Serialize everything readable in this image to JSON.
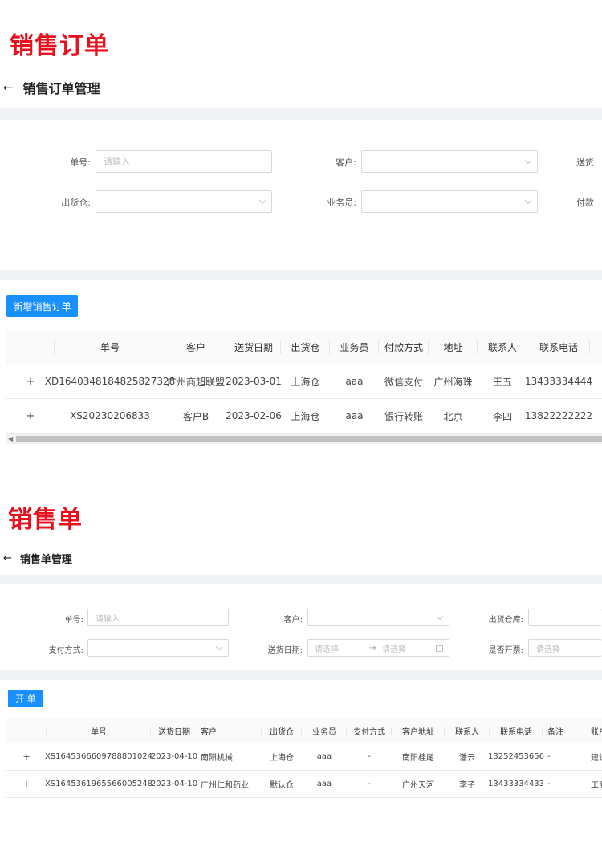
{
  "section1": {
    "big_title": "销售订单",
    "page_title": "销售订单管理",
    "filters": {
      "order_no_label": "单号:",
      "order_no_placeholder": "请输入",
      "customer_label": "客户:",
      "ship_date_label": "送货",
      "warehouse_label": "出货仓:",
      "salesperson_label": "业务员:",
      "payment_label": "付款"
    },
    "add_button": "新增销售订单",
    "columns": [
      "单号",
      "客户",
      "送货日期",
      "出货仓",
      "业务员",
      "付款方式",
      "地址",
      "联系人",
      "联系电话"
    ],
    "rows": [
      {
        "expand": "+",
        "cells": [
          "XD1640348184825827328",
          "广州商超联盟",
          "2023-03-01",
          "上海仓",
          "aaa",
          "微信支付",
          "广州海珠",
          "王五",
          "13433334444"
        ]
      },
      {
        "expand": "+",
        "cells": [
          "XS20230206833",
          "客户B",
          "2023-02-06",
          "上海仓",
          "aaa",
          "银行转账",
          "北京",
          "李四",
          "13822222222"
        ]
      }
    ]
  },
  "section2": {
    "big_title": "销售单",
    "page_title": "销售单管理",
    "filters": {
      "order_no_label": "单号:",
      "order_no_placeholder": "请输入",
      "customer_label": "客户:",
      "warehouse_label": "出货仓库:",
      "payment_label": "支付方式:",
      "ship_date_label": "送货日期:",
      "date_start_placeholder": "请选择",
      "date_sep": "→",
      "date_end_placeholder": "请选择",
      "invoice_label": "是否开票:",
      "invoice_placeholder": "请选择"
    },
    "open_button": "开 单",
    "columns": [
      "单号",
      "送货日期",
      "客户",
      "出货仓",
      "业务员",
      "支付方式",
      "客户地址",
      "联系人",
      "联系电话",
      "备注",
      "账户"
    ],
    "rows": [
      {
        "expand": "+",
        "cells": [
          "XS1645366609788801024",
          "2023-04-10",
          "南阳机械",
          "上海仓",
          "aaa",
          "-",
          "南阳桂尾",
          "潘云",
          "13252453656",
          "-",
          "建设"
        ]
      },
      {
        "expand": "+",
        "cells": [
          "XS1645361965566005248",
          "2023-04-10",
          "广州仁和药业",
          "默认仓",
          "aaa",
          "-",
          "广州天河",
          "李子",
          "13433334433",
          "-",
          "工商"
        ]
      }
    ]
  },
  "icons": {
    "back": "arrow-left-icon",
    "chevron": "chevron-down-icon",
    "calendar": "calendar-icon",
    "expand": "plus-icon"
  },
  "colors": {
    "accent": "#1890ff",
    "title_red": "#e8101c",
    "band_gray": "#f0f2f5"
  }
}
